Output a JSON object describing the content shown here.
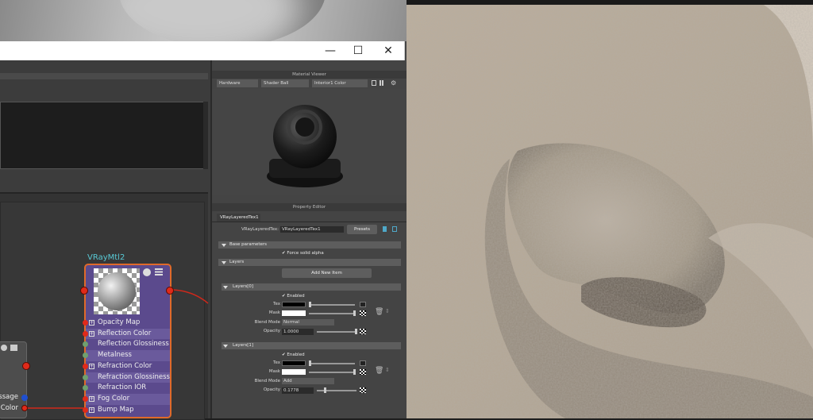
{
  "window": {
    "minimize": "—",
    "maximize": "☐",
    "close": "✕"
  },
  "node": {
    "title": "VRayMtl2",
    "rows": [
      "Opacity Map",
      "Reflection Color",
      "Reflection Glossiness",
      "Metalness",
      "Refraction Color",
      "Refraction Glossiness",
      "Refraction IOR",
      "Fog Color",
      "Bump Map"
    ],
    "expandable": [
      true,
      true,
      false,
      false,
      true,
      false,
      false,
      true,
      true
    ]
  },
  "node2": {
    "rows": [
      "ssage",
      "Color"
    ]
  },
  "material_viewer": {
    "title": "Material Viewer",
    "renderer": "Hardware",
    "shape": "Shader Ball",
    "environment": "Interior1 Color"
  },
  "property_editor": {
    "title": "Property Editor",
    "tab": "VRayLayeredTex1",
    "name_label": "VRayLayeredTex:",
    "name_value": "VRayLayeredTex1",
    "presets_label": "Presets",
    "base_parameters": "Base parameters",
    "force_solid_alpha": "Force solid alpha",
    "layers": "Layers",
    "add_new_item": "Add New Item",
    "layer0": {
      "header": "Layers[0]",
      "enabled": "Enabled",
      "tex": "Tex",
      "mask": "Mask",
      "blend_mode_label": "Blend Mode",
      "blend_mode": "Normal",
      "opacity_label": "Opacity",
      "opacity": "1.0000",
      "opacity_fraction": 1.0
    },
    "layer1": {
      "header": "Layers[1]",
      "enabled": "Enabled",
      "tex": "Tex",
      "mask": "Mask",
      "blend_mode_label": "Blend Mode",
      "blend_mode": "Add",
      "opacity_label": "Opacity",
      "opacity": "0.1778",
      "opacity_fraction": 0.1778
    }
  },
  "colors": {
    "node_body": "#5b4a8d",
    "node_title": "#58c8d4",
    "port_red": "#e02a1a",
    "skin": "#b7aa9a"
  }
}
